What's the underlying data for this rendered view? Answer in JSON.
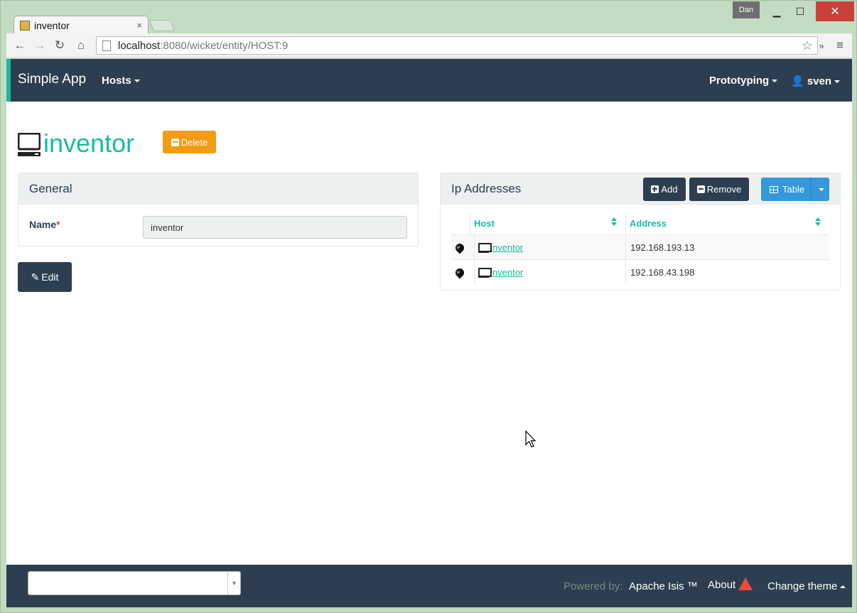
{
  "window": {
    "user_badge": "Dan",
    "min_icon": "minimize-icon",
    "max_icon": "maximize-icon",
    "close_icon": "close-icon"
  },
  "browser": {
    "tab_title": "inventor",
    "tab_close": "×",
    "url_host": "localhost",
    "url_rest": ":8080/wicket/entity/HOST:9",
    "more_label": "»"
  },
  "navbar": {
    "brand": "Simple App",
    "menu_hosts": "Hosts",
    "menu_prototyping": "Prototyping",
    "menu_user": "sven"
  },
  "entity": {
    "title": "inventor",
    "delete_label": "Delete"
  },
  "general": {
    "heading": "General",
    "name_label": "Name",
    "required_mark": "*",
    "name_value": "inventor",
    "edit_label": "Edit"
  },
  "ip_addresses": {
    "heading": "Ip Addresses",
    "add_label": "Add",
    "remove_label": "Remove",
    "table_label": "Table",
    "columns": [
      "Host",
      "Address"
    ],
    "rows": [
      {
        "host": "inventor",
        "address": "192.168.193.13"
      },
      {
        "host": "inventor",
        "address": "192.168.43.198"
      }
    ]
  },
  "footer": {
    "select_value": "",
    "powered_by": "Powered by:",
    "framework": "Apache Isis ™",
    "about": "About",
    "change_theme": "Change theme"
  },
  "colors": {
    "navbar": "#2c3e50",
    "accent": "#18bc9c",
    "delete": "#f39c12",
    "table_button": "#3498db",
    "warning": "#e74c3c"
  }
}
